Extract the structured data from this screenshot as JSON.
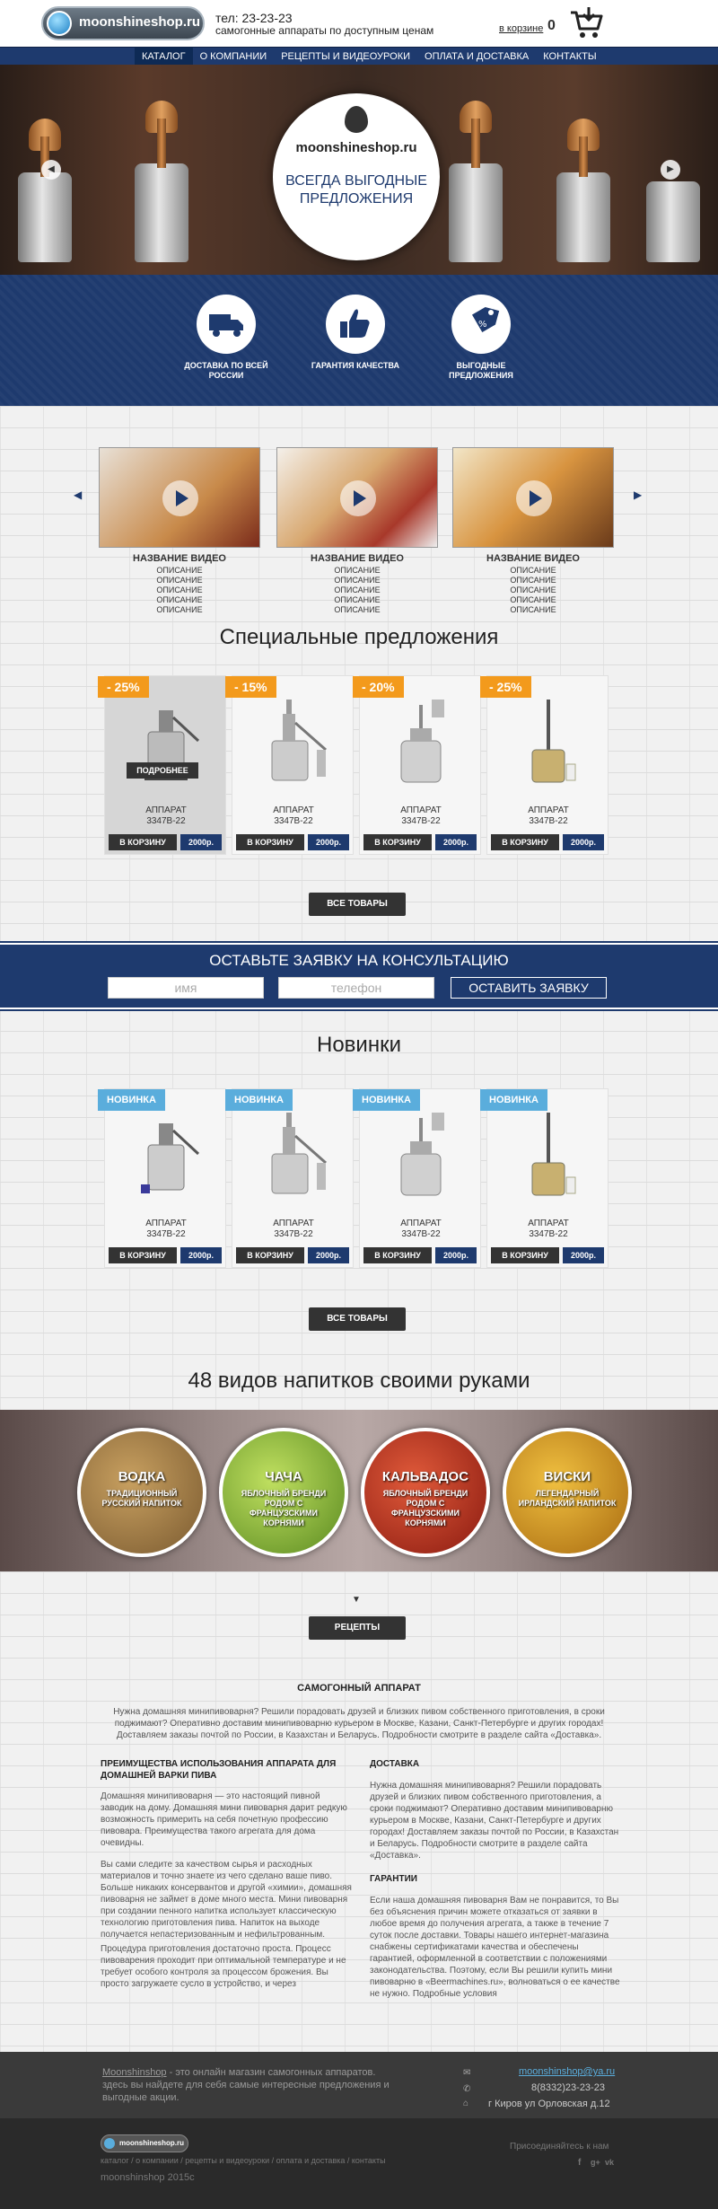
{
  "header": {
    "logo_text": "moonshineshop.ru",
    "phone": "тел: 23-23-23",
    "tagline": "самогонные аппараты по доступным ценам",
    "cart_label": "в корзине",
    "cart_count": "0",
    "cart_icon": "cart-icon"
  },
  "nav": {
    "items": [
      "КАТАЛОГ",
      "О КОМПАНИИ",
      "РЕЦЕПТЫ И ВИДЕОУРОКИ",
      "ОПЛАТА И ДОСТАВКА",
      "КОНТАКТЫ"
    ]
  },
  "hero": {
    "brand": "moonshineshop.ru",
    "slogan": "ВСЕГДА ВЫГОДНЫЕ ПРЕДЛОЖЕНИЯ"
  },
  "features": [
    {
      "icon": "truck-icon",
      "label": "ДОСТАВКА ПО ВСЕЙ РОССИИ"
    },
    {
      "icon": "thumbs-up-icon",
      "label": "ГАРАНТИЯ КАЧЕСТВА"
    },
    {
      "icon": "price-tag-icon",
      "label": "ВЫГОДНЫЕ ПРЕДЛОЖЕНИЯ"
    }
  ],
  "videos": [
    {
      "title": "НАЗВАНИЕ ВИДЕО",
      "desc": "ОПИСАНИЕ ОПИСАНИЕ ОПИСАНИЕ ОПИСАНИЕ ОПИСАНИЕ"
    },
    {
      "title": "НАЗВАНИЕ ВИДЕО",
      "desc": "ОПИСАНИЕ ОПИСАНИЕ ОПИСАНИЕ ОПИСАНИЕ ОПИСАНИЕ"
    },
    {
      "title": "НАЗВАНИЕ ВИДЕО",
      "desc": "ОПИСАНИЕ ОПИСАНИЕ ОПИСАНИЕ ОПИСАНИЕ ОПИСАНИЕ"
    }
  ],
  "special": {
    "title": "Специальные предложения",
    "more_label": "ПОДРОБНЕЕ",
    "products": [
      {
        "badge": "- 25%",
        "name": "АППАРАТ",
        "code": "3347В-22",
        "buy": "В КОРЗИНУ",
        "price": "2000р."
      },
      {
        "badge": "- 15%",
        "name": "АППАРАТ",
        "code": "3347В-22",
        "buy": "В КОРЗИНУ",
        "price": "2000р."
      },
      {
        "badge": "- 20%",
        "name": "АППАРАТ",
        "code": "3347В-22",
        "buy": "В КОРЗИНУ",
        "price": "2000р."
      },
      {
        "badge": "- 25%",
        "name": "АППАРАТ",
        "code": "3347В-22",
        "buy": "В КОРЗИНУ",
        "price": "2000р."
      }
    ],
    "all_button": "ВСЕ ТОВАРЫ"
  },
  "consult": {
    "title": "ОСТАВЬТЕ ЗАЯВКУ НА КОНСУЛЬТАЦИЮ",
    "name_placeholder": "имя",
    "phone_placeholder": "телефон",
    "submit": "ОСТАВИТЬ ЗАЯВКУ"
  },
  "new": {
    "title": "Новинки",
    "products": [
      {
        "badge": "НОВИНКА",
        "name": "АППАРАТ",
        "code": "3347В-22",
        "buy": "В КОРЗИНУ",
        "price": "2000р."
      },
      {
        "badge": "НОВИНКА",
        "name": "АППАРАТ",
        "code": "3347В-22",
        "buy": "В КОРЗИНУ",
        "price": "2000р."
      },
      {
        "badge": "НОВИНКА",
        "name": "АППАРАТ",
        "code": "3347В-22",
        "buy": "В КОРЗИНУ",
        "price": "2000р."
      },
      {
        "badge": "НОВИНКА",
        "name": "АППАРАТ",
        "code": "3347В-22",
        "buy": "В КОРЗИНУ",
        "price": "2000р."
      }
    ],
    "all_button": "ВСЕ ТОВАРЫ"
  },
  "drinks": {
    "title": "48 видов напитков своими руками",
    "items": [
      {
        "name": "ВОДКА",
        "desc": "ТРАДИЦИОННЫЙ РУССКИЙ НАПИТОК"
      },
      {
        "name": "ЧАЧА",
        "desc": "ЯБЛОЧНЫЙ БРЕНДИ РОДОМ С ФРАНЦУЗСКИМИ КОРНЯМИ"
      },
      {
        "name": "КАЛЬВАДОС",
        "desc": "ЯБЛОЧНЫЙ БРЕНДИ РОДОМ С ФРАНЦУЗСКИМИ КОРНЯМИ"
      },
      {
        "name": "ВИСКИ",
        "desc": "ЛЕГЕНДАРНЫЙ ИРЛАНДСКИЙ НАПИТОК"
      }
    ],
    "recipes_button": "РЕЦЕПТЫ"
  },
  "about": {
    "title": "САМОГОННЫЙ АППАРАТ",
    "intro": "Нужна домашняя минипивоварня? Решили порадовать друзей и близких пивом собственного приготовления, в сроки поджимают? Оперативно доставим минипивоварню курьером в Москве, Казани, Санкт-Петербурге и других городах! Доставляем заказы почтой по России, в Казахстан и Беларусь. Подробности смотрите в разделе сайта «Доставка».",
    "left_title": "ПРЕИМУЩЕСТВА ИСПОЛЬЗОВАНИЯ АППАРАТА ДЛЯ ДОМАШНЕЙ ВАРКИ ПИВА",
    "left_p1": "Домашняя минипивоварня — это настоящий пивной заводик на дому. Домашняя мини пивоварня дарит редкую возможность примерить на себя почетную профессию пивовара. Преимущества такого агрегата для дома очевидны.",
    "left_p2": "Вы сами следите за качеством сырья и расходных материалов и точно знаете из чего сделано ваше пиво. Больше никаких консервантов и другой «химии», домашняя пивоварня не займет в доме много места. Мини пивоварня при создании пенного напитка использует классическую технологию приготовления пива. Напиток на выходе получается непастеризованным и нефильтрованным.",
    "left_p3": "Процедура приготовления достаточно проста. Процесс пивоварения проходит при оптимальной температуре и не требует особого контроля за процессом брожения. Вы просто загружаете сусло в устройство, и через",
    "right_title1": "ДОСТАВКА",
    "right_p1": "Нужна домашняя минипивоварня? Решили порадовать друзей и близких пивом собственного приготовления, а сроки поджимают? Оперативно доставим минипивоварню курьером в Москве, Казани, Санкт-Петербурге и других городах! Доставляем заказы почтой по России, в Казахстан и Беларусь. Подробности смотрите в разделе сайта «Доставка».",
    "right_title2": "ГАРАНТИИ",
    "right_p2": "Если наша домашняя пивоварня Вам не понравится, то Вы без объяснения причин можете отказаться от заявки в любое время до получения агрегата, а также в течение 7 суток после доставки. Товары нашего интернет-магазина снабжены сертификатами качества и обеспечены гарантией, оформленной в соответствии с положениями законодательства. Поэтому, если Вы решили купить мини пивоварню в «Beermachines.ru», волноваться о ее качестве не нужно. Подробные условия"
  },
  "footer": {
    "about_link": "Moonshinshop",
    "about_text": " - это онлайн магазин самогонных аппаратов. здесь вы найдете для себя самые интересные предложения и выгодные акции.",
    "email": "moonshinshop@ya.ru",
    "phone": "8(8332)23-23-23",
    "address": "г Киров ул Орловская д.12",
    "logo_text": "moonshineshop.ru",
    "links": "каталог  /  о компании  /  рецепты и видеоуроки  /  оплата и доставка  /  контакты",
    "copyright": "moonshinshop 2015с",
    "join": "Присоединяйтесь к нам",
    "social": [
      "facebook-icon",
      "google-plus-icon",
      "vk-icon"
    ]
  }
}
